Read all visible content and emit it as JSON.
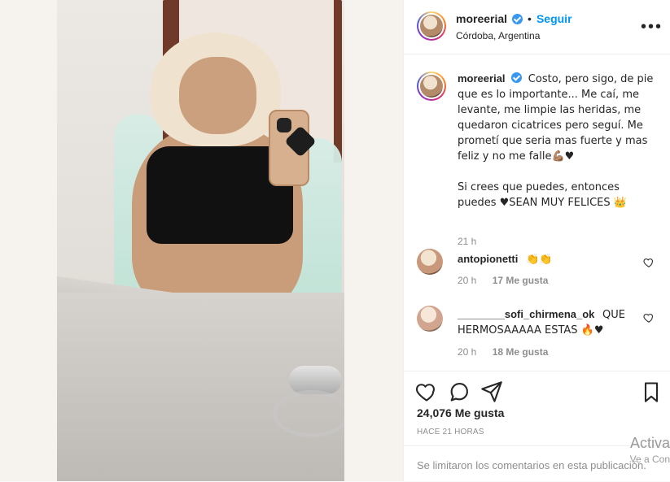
{
  "post": {
    "username": "moreerial",
    "verified": true,
    "follow_label": "Seguir",
    "location": "Córdoba, Argentina",
    "more_label": "•••"
  },
  "caption": {
    "text": "Costo, pero sigo, de pie que es lo importante... Me caí, me levante, me limpie las heridas, me quedaron cicatrices pero seguí. Me prometí que seria mas fuerte y mas feliz y no me falle💪🏽♥\n\nSi crees que puedes, entonces puedes ♥SEAN MUY FELICES 👑",
    "age": "21 h"
  },
  "comments": [
    {
      "username": "antopionetti",
      "text": "👏👏",
      "age": "20 h",
      "likes": "17 Me gusta"
    },
    {
      "username": "________sofi_chirmena_ok",
      "text": "QUE HERMOSAAAAA ESTAS 🔥♥",
      "age": "20 h",
      "likes": "18 Me gusta"
    }
  ],
  "actions": {
    "likes_count": "24,076 Me gusta",
    "posted_ago": "HACE 21 HORAS",
    "comments_limited": "Se limitaron los comentarios en esta publicación."
  },
  "watermark": {
    "line1": "Activa",
    "line2": "Ve a Con"
  },
  "icons": {
    "more": "more-options-icon",
    "like": "heart-icon",
    "comment": "comment-icon",
    "share": "share-icon",
    "save": "bookmark-icon",
    "comment_like": "heart-outline-icon",
    "verified": "verified-badge-icon"
  },
  "colors": {
    "accent": "#0095f6",
    "verified": "#3897f0",
    "muted": "#8e8e8e"
  }
}
